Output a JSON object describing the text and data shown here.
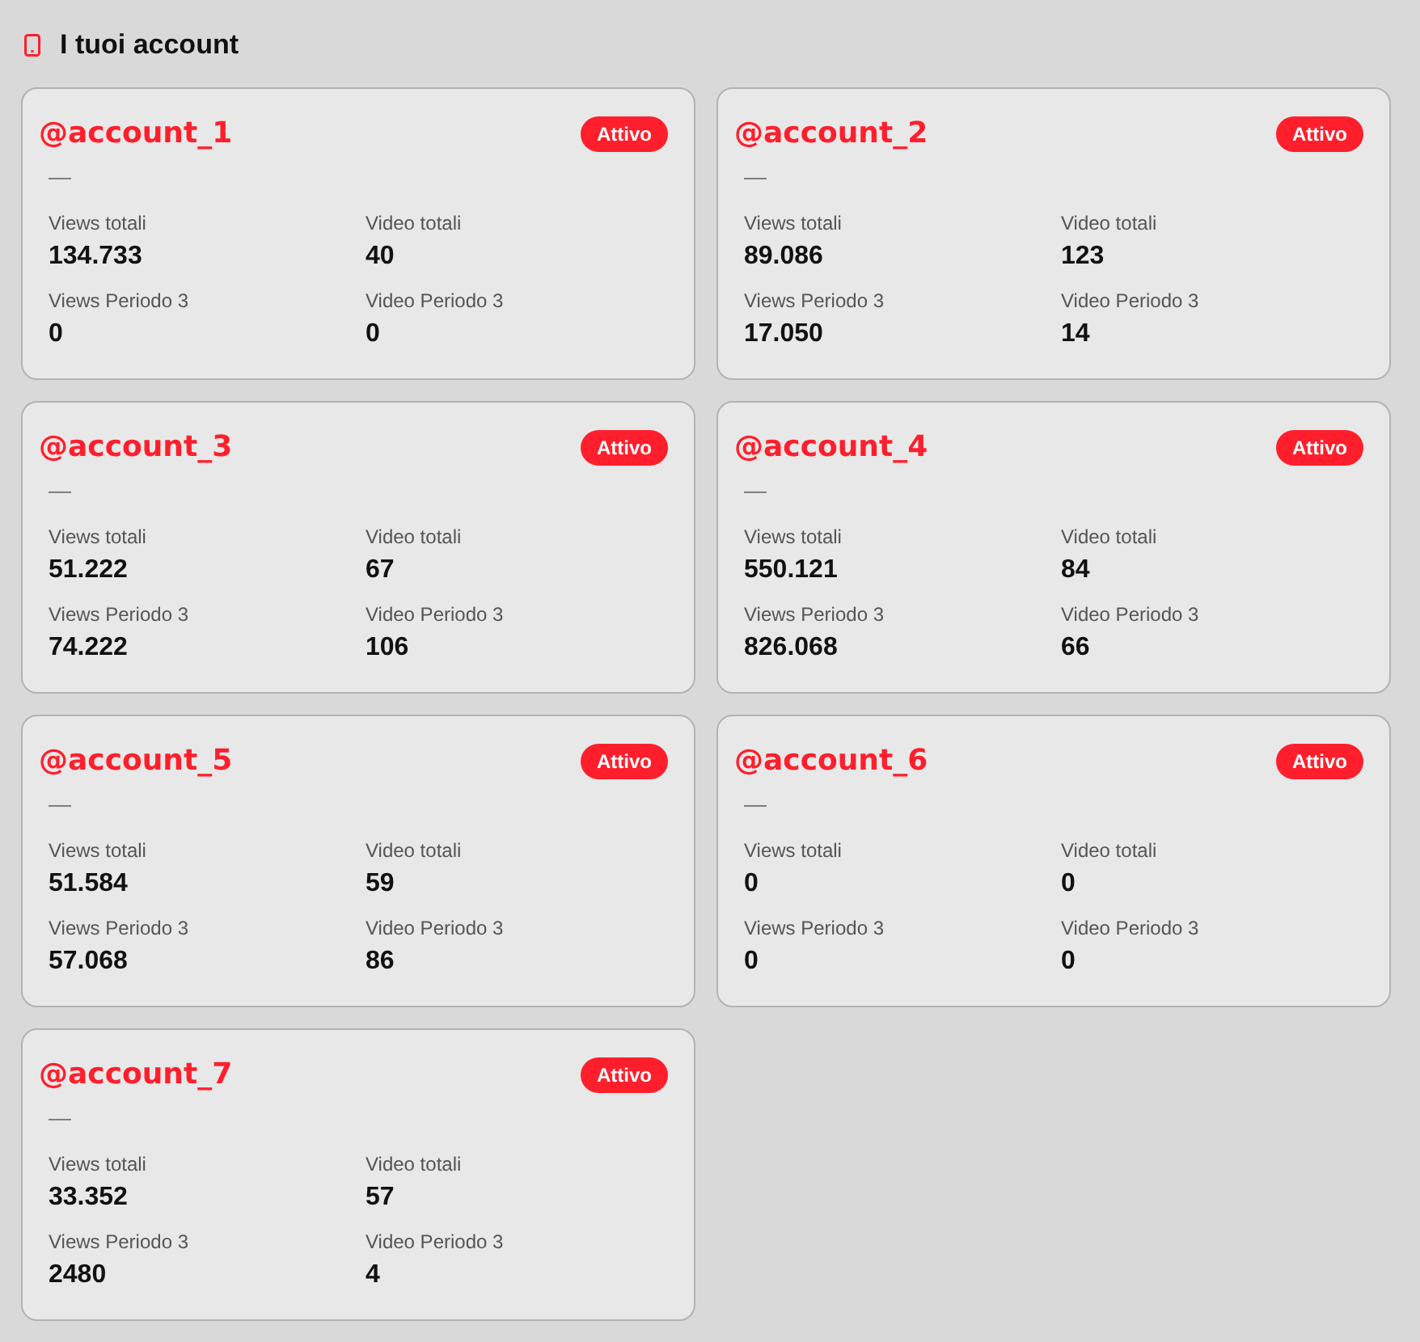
{
  "header": {
    "title": "I tuoi account"
  },
  "accounts": [
    {
      "handle": "@account_1",
      "status": "Attivo",
      "subtitle": "—",
      "stats": [
        {
          "label": "Views totali",
          "value": "134.733"
        },
        {
          "label": "Video totali",
          "value": "40"
        },
        {
          "label": "Views Periodo 3",
          "value": "0"
        },
        {
          "label": "Video Periodo 3",
          "value": "0"
        }
      ]
    },
    {
      "handle": "@account_2",
      "status": "Attivo",
      "subtitle": "—",
      "stats": [
        {
          "label": "Views totali",
          "value": "89.086"
        },
        {
          "label": "Video totali",
          "value": "123"
        },
        {
          "label": "Views Periodo 3",
          "value": "17.050"
        },
        {
          "label": "Video Periodo 3",
          "value": "14"
        }
      ]
    },
    {
      "handle": "@account_3",
      "status": "Attivo",
      "subtitle": "—",
      "stats": [
        {
          "label": "Views totali",
          "value": "51.222"
        },
        {
          "label": "Video totali",
          "value": "67"
        },
        {
          "label": "Views Periodo 3",
          "value": "74.222"
        },
        {
          "label": "Video Periodo 3",
          "value": "106"
        }
      ]
    },
    {
      "handle": "@account_4",
      "status": "Attivo",
      "subtitle": "—",
      "stats": [
        {
          "label": "Views totali",
          "value": "550.121"
        },
        {
          "label": "Video totali",
          "value": "84"
        },
        {
          "label": "Views Periodo 3",
          "value": "826.068"
        },
        {
          "label": "Video Periodo 3",
          "value": "66"
        }
      ]
    },
    {
      "handle": "@account_5",
      "status": "Attivo",
      "subtitle": "—",
      "stats": [
        {
          "label": "Views totali",
          "value": "51.584"
        },
        {
          "label": "Video totali",
          "value": "59"
        },
        {
          "label": "Views Periodo 3",
          "value": "57.068"
        },
        {
          "label": "Video Periodo 3",
          "value": "86"
        }
      ]
    },
    {
      "handle": "@account_6",
      "status": "Attivo",
      "subtitle": "—",
      "stats": [
        {
          "label": "Views totali",
          "value": "0"
        },
        {
          "label": "Video totali",
          "value": "0"
        },
        {
          "label": "Views Periodo 3",
          "value": "0"
        },
        {
          "label": "Video Periodo 3",
          "value": "0"
        }
      ]
    },
    {
      "handle": "@account_7",
      "status": "Attivo",
      "subtitle": "—",
      "stats": [
        {
          "label": "Views totali",
          "value": "33.352"
        },
        {
          "label": "Video totali",
          "value": "57"
        },
        {
          "label": "Views Periodo 3",
          "value": "2480"
        },
        {
          "label": "Video Periodo 3",
          "value": "4"
        }
      ]
    }
  ]
}
